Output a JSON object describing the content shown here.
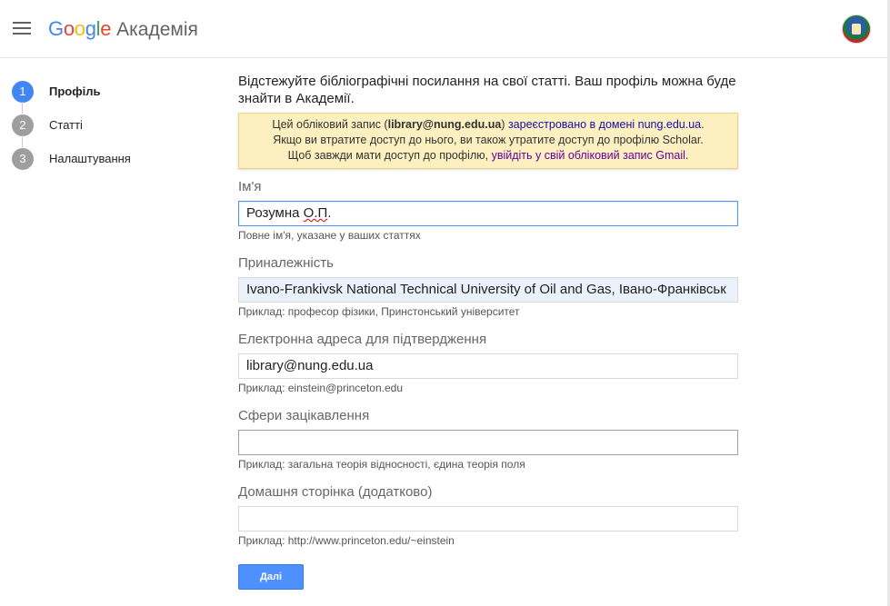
{
  "header": {
    "logo_text": "Google",
    "product": "Академія",
    "menu_icon": "hamburger-icon",
    "avatar_icon": "user-avatar"
  },
  "steps": [
    {
      "number": "1",
      "label": "Профіль",
      "active": true
    },
    {
      "number": "2",
      "label": "Статті",
      "active": false
    },
    {
      "number": "3",
      "label": "Налаштування",
      "active": false
    }
  ],
  "intro": "Відстежуйте бібліографічні посилання на свої статті. Ваш профіль можна буде знайти в Академії.",
  "notice": {
    "line1_prefix": "Цей обліковий запис (",
    "line1_email": "library@nung.edu.ua",
    "line1_mid": ") ",
    "line1_link": "зареєстровано в домені nung.edu.ua",
    "line1_suffix": ".",
    "line2": "Якщо ви втратите доступ до нього, ви також утратите доступ до профілю Scholar.",
    "line3_prefix": "Щоб завжди мати доступ до профілю, ",
    "line3_link": "увійдіть у свій обліковий запис Gmail",
    "line3_suffix": "."
  },
  "fields": {
    "name": {
      "label": "Ім'я",
      "value_part1": "Розумна ",
      "value_part2": "О.П",
      "value_part3": ".",
      "hint": "Повне ім'я, указане у ваших статтях"
    },
    "affiliation": {
      "label": "Приналежність",
      "value": "Ivano-Frankivsk National Technical University of Oil and Gas, Івано-Франківськ",
      "hint": "Приклад: професор фізики, Принстонський університет"
    },
    "email": {
      "label": "Електронна адреса для підтвердження",
      "value": "library@nung.edu.ua",
      "hint": "Приклад: einstein@princeton.edu"
    },
    "interests": {
      "label": "Сфери зацікавлення",
      "value": "",
      "hint": "Приклад: загальна теорія відносності, єдина теорія поля"
    },
    "homepage": {
      "label": "Домашня сторінка (додатково)",
      "value": "",
      "hint": "Приклад: http://www.princeton.edu/~einstein"
    }
  },
  "next_button": "Далі",
  "colors": {
    "accent": "#4285f4",
    "button": "#4d90fe",
    "notice_bg": "#fcf0c0",
    "link": "#1a0dab"
  }
}
